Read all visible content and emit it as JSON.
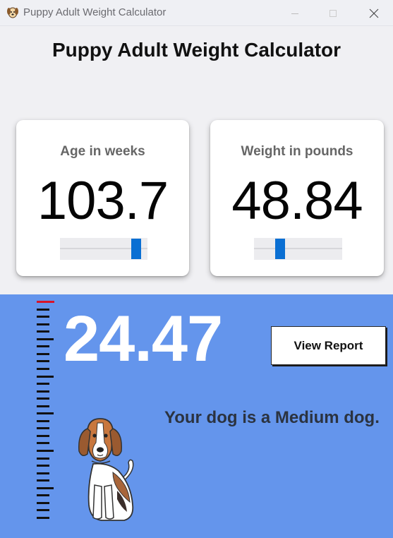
{
  "window": {
    "title": "Puppy Adult Weight Calculator",
    "icons": {
      "app": "puppy-icon",
      "minimize": "minimize-icon",
      "maximize": "maximize-icon",
      "close": "close-icon"
    }
  },
  "header": {
    "title": "Puppy Adult Weight Calculator"
  },
  "age_card": {
    "label": "Age in weeks",
    "value": "103.7",
    "slider_position": 0.92
  },
  "weight_card": {
    "label": "Weight in pounds",
    "value": "48.84",
    "slider_position": 0.27
  },
  "result": {
    "value": "24.47",
    "report_button_label": "View Report",
    "size_message": "Your dog is a Medium dog.",
    "ruler_level_icon": "ruler-scale",
    "illustration": "beagle-dog-illustration"
  },
  "colors": {
    "panel": "#6495ec",
    "slider_thumb": "#0a6fd3",
    "ruler_marker": "#d8142a",
    "background": "#f0f0f3"
  }
}
